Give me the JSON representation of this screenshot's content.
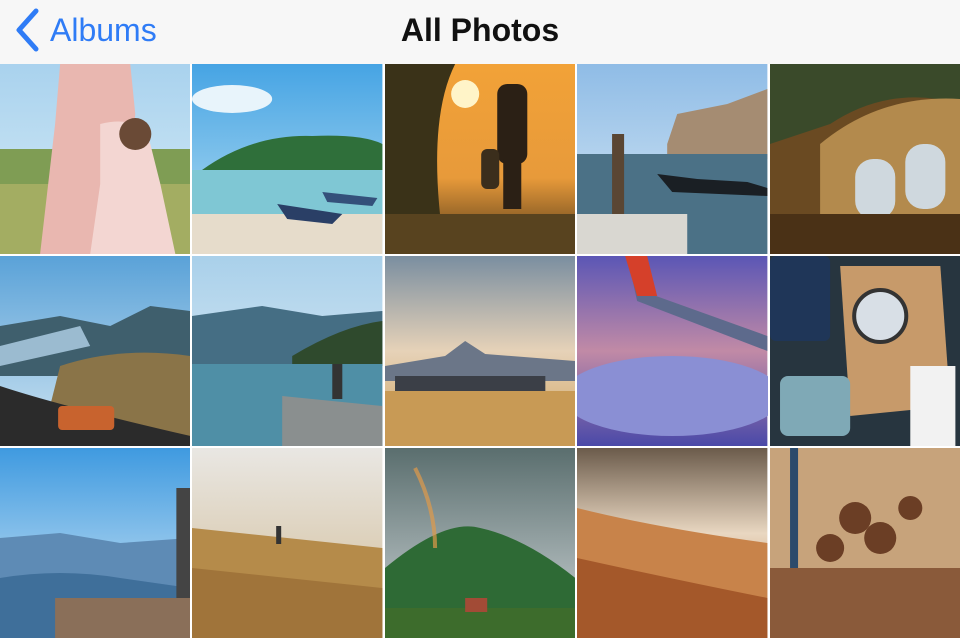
{
  "nav": {
    "back_label": "Albums",
    "title": "All Photos"
  },
  "photos": [
    "mother-and-daughter-in-meadow",
    "lake-island-with-boats",
    "father-and-child-at-sunset",
    "venice-gondola-canal",
    "grand-central-terminal-windows",
    "river-gorge-road-with-van",
    "mountain-lake-pier",
    "mountain-airport-hangar",
    "airplane-wing-over-clouds",
    "map-passport-magnifier-flatlay",
    "canyon-cliff-overlook",
    "golden-grass-field-child",
    "rainbow-over-green-mountain",
    "desert-sand-dunes",
    "pine-cones-on-wood"
  ],
  "colors": {
    "accent": "#2f7cf6",
    "navbar": "#f7f7f7"
  }
}
